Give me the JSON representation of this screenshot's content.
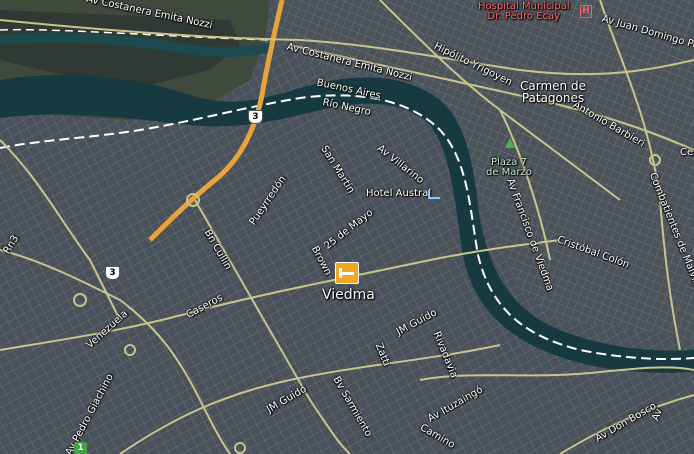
{
  "map": {
    "colors": {
      "water": "#163a3f",
      "urban": "#4a5258",
      "road_major": "#e8a33a",
      "road": "#c9c48c",
      "border": "#ffffff"
    },
    "streets": [
      {
        "key": "costanera_1",
        "text": "Av Costanera Emita Nozzi"
      },
      {
        "key": "costanera_2",
        "text": "Av Costanera Emita Nozzi"
      },
      {
        "key": "hipolito",
        "text": "Hipólito Yrigoyen"
      },
      {
        "key": "juan_domingo",
        "text": "Av Juan Domingo Pe"
      },
      {
        "key": "antonio",
        "text": "Antonio Barbieri"
      },
      {
        "key": "villarino",
        "text": "Av Villarino"
      },
      {
        "key": "sanmartin",
        "text": "San Martín"
      },
      {
        "key": "rn3",
        "text": "Rn3"
      },
      {
        "key": "pueyrredon",
        "text": "Pueyrredón"
      },
      {
        "key": "25mayo",
        "text": "25 de Mayo"
      },
      {
        "key": "brown",
        "text": "Brown"
      },
      {
        "key": "bcollin",
        "text": "Bn Cullin"
      },
      {
        "key": "francisco",
        "text": "Av Francisco de Viedma"
      },
      {
        "key": "cristobal",
        "text": "Cristóbal Colón"
      },
      {
        "key": "combatientes",
        "text": "Combatientes de Malvinas"
      },
      {
        "key": "caseros",
        "text": "Caseros"
      },
      {
        "key": "venezuela",
        "text": "Venezuela"
      },
      {
        "key": "jmguido_1",
        "text": "JM Guido"
      },
      {
        "key": "jmguido_2",
        "text": "JM Guido"
      },
      {
        "key": "zatti",
        "text": "Zatti"
      },
      {
        "key": "rivadavia",
        "text": "Rivadavia"
      },
      {
        "key": "ituzaingo",
        "text": "Av Ituzaingó"
      },
      {
        "key": "bystraat",
        "text": "Bv Sarmiento"
      },
      {
        "key": "pedro",
        "text": "Av Pedro Giachino"
      },
      {
        "key": "camino",
        "text": "Camino"
      },
      {
        "key": "donbosco",
        "text": "Av Don Bosco"
      },
      {
        "key": "av_right",
        "text": "Av"
      },
      {
        "key": "ce",
        "text": "Ce"
      }
    ],
    "places": {
      "hospital_line1": "Hospital Municipal",
      "hospital_line2": "Dr. Pedro Ecay",
      "carmen_line1": "Carmen de",
      "carmen_line2": "Patagones",
      "river_line1": "Buenos Aires",
      "river_line2": "Río Negro",
      "plaza_line1": "Plaza 7",
      "plaza_line2": "de Marzo",
      "hotel": "Hotel Austral",
      "city": "Viedma"
    },
    "route_shields": [
      {
        "key": "rn3_a",
        "text": "3"
      },
      {
        "key": "rn3_b",
        "text": "3"
      }
    ],
    "badge": "1",
    "icons": [
      "hospital-icon",
      "park-icon",
      "hotel-icon",
      "lodging-icon"
    ]
  }
}
